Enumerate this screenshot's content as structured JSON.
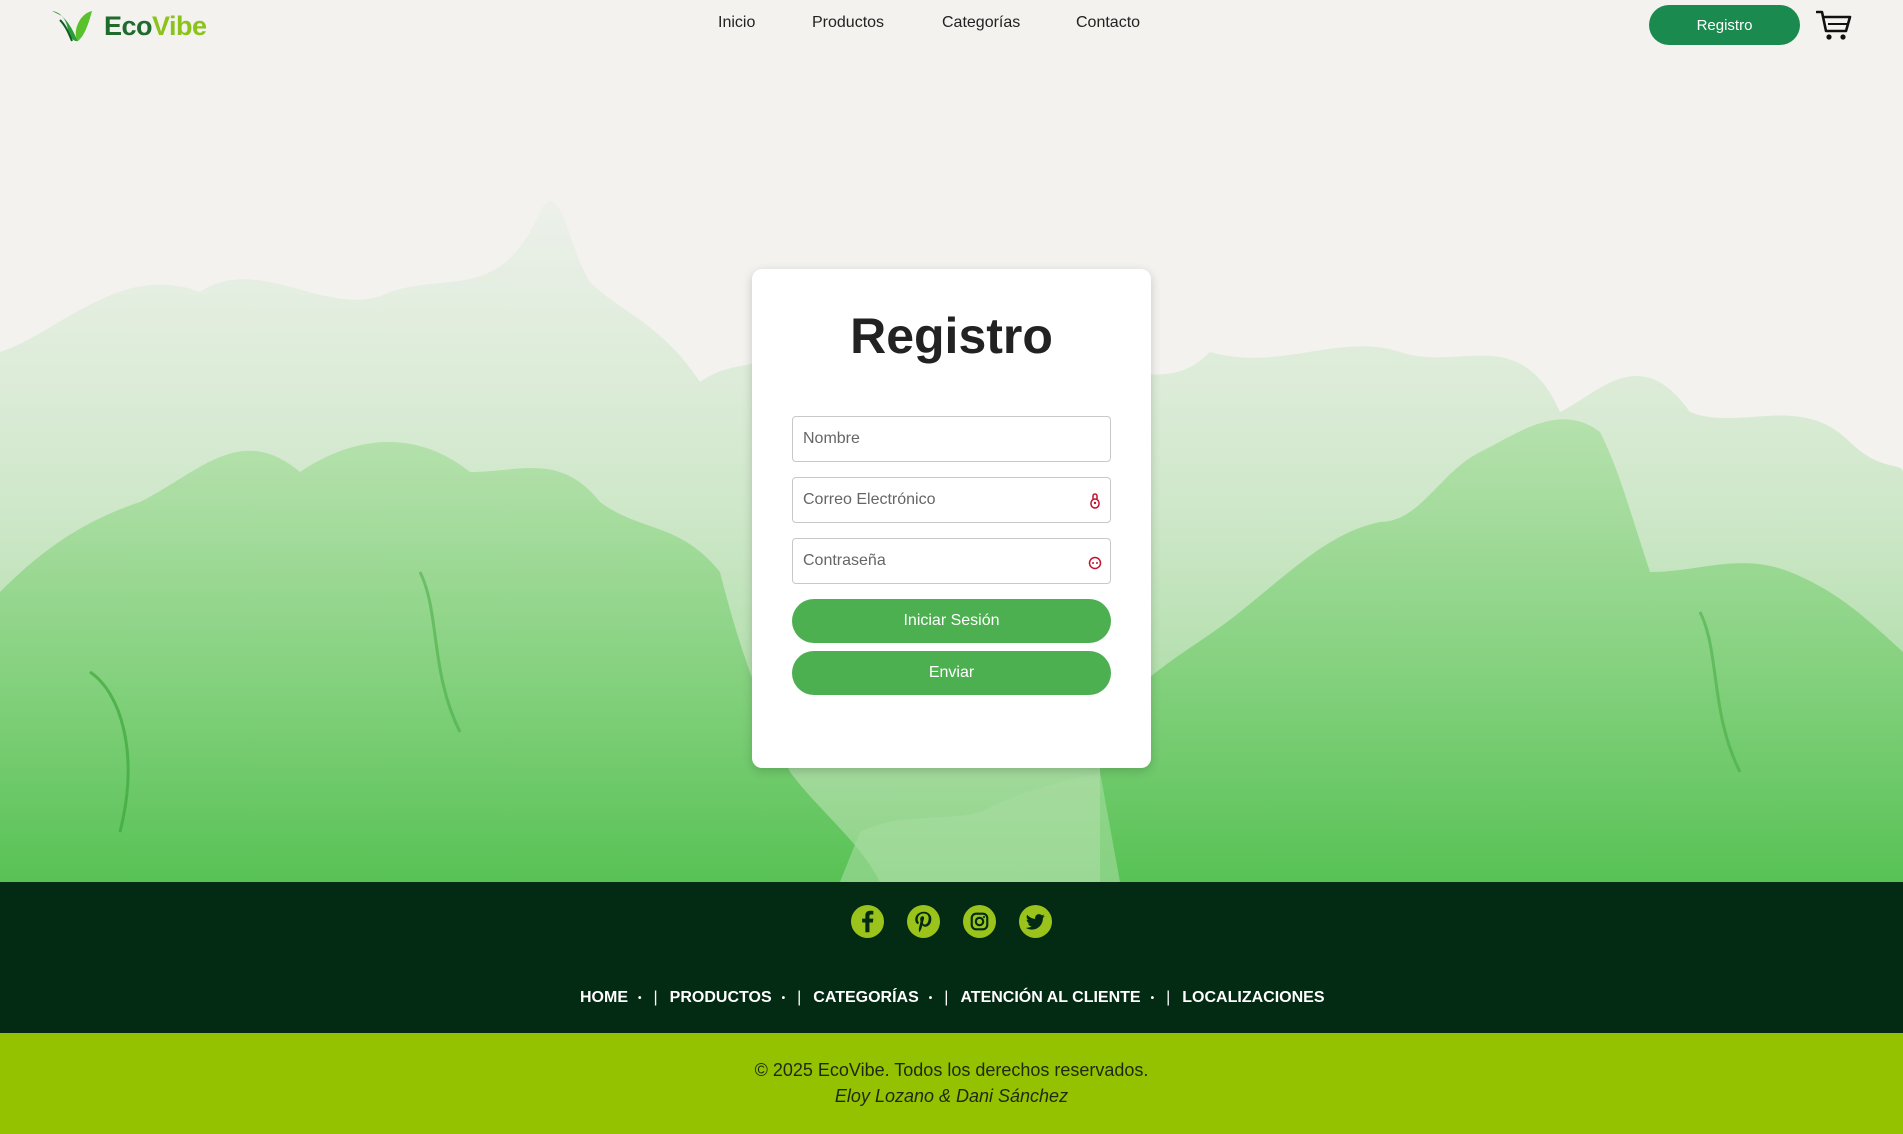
{
  "brand": {
    "part1": "Eco",
    "part2": "Vibe"
  },
  "nav": {
    "items": [
      {
        "label": "Inicio"
      },
      {
        "label": "Productos"
      },
      {
        "label": "Categorías"
      },
      {
        "label": "Contacto"
      }
    ]
  },
  "header": {
    "register_label": "Registro"
  },
  "form": {
    "title": "Registro",
    "name_placeholder": "Nombre",
    "email_placeholder": "Correo Electrónico",
    "password_placeholder": "Contraseña",
    "login_label": "Iniciar Sesión",
    "submit_label": "Enviar"
  },
  "footer": {
    "socials": [
      "facebook-icon",
      "pinterest-icon",
      "instagram-icon",
      "twitter-icon"
    ],
    "links": [
      {
        "label": "HOME"
      },
      {
        "label": "PRODUCTOS"
      },
      {
        "label": "CATEGORÍAS"
      },
      {
        "label": "ATENCIÓN AL CLIENTE"
      },
      {
        "label": "LOCALIZACIONES"
      }
    ],
    "copyright": "© 2025 EcoVibe. Todos los derechos reservados.",
    "authors": "Eloy Lozano & Dani Sánchez"
  },
  "colors": {
    "primary_green": "#1a8a4f",
    "button_green": "#4caf50",
    "footer_dark": "#032a12",
    "footer_lime": "#94c100",
    "social_icon": "#9ac31c"
  }
}
